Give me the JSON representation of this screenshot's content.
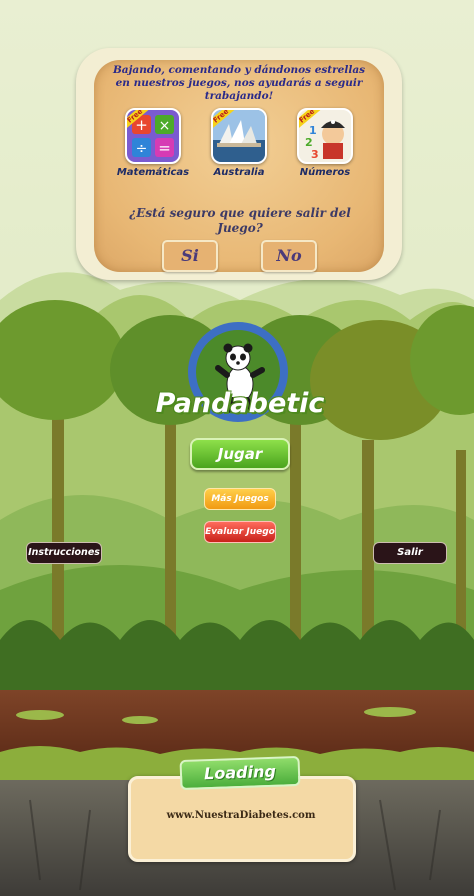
{
  "dialog": {
    "message": "Bajando, comentando y dándonos estrellas en nuestros juegos, nos ayudarás a seguir trabajando!",
    "apps": [
      {
        "label": "Matemáticas",
        "badge": "Free",
        "icon": "math-symbols-icon"
      },
      {
        "label": "Australia",
        "badge": "Free",
        "icon": "sydney-opera-icon"
      },
      {
        "label": "Números",
        "badge": "Free",
        "icon": "pirate-numbers-icon"
      }
    ],
    "question": "¿Está seguro que quiere salir del Juego?",
    "yes_label": "Si",
    "no_label": "No"
  },
  "game": {
    "title": "Pandabetic",
    "play_label": "Jugar",
    "more_games_label": "Más Juegos",
    "rate_label": "Evaluar Juego",
    "instructions_label": "Instrucciones",
    "exit_label": "Salir"
  },
  "loading": {
    "label": "Loading",
    "url": "www.NuestraDiabetes.com"
  },
  "colors": {
    "sky": "#e6eed0",
    "jungle_dark": "#4f7a2a",
    "jungle_light": "#9cc85a",
    "trunk": "#7a7a28",
    "ground": "#7a3a22",
    "rock": "#5a5a56",
    "panda_ring": "#3d6fc4"
  }
}
